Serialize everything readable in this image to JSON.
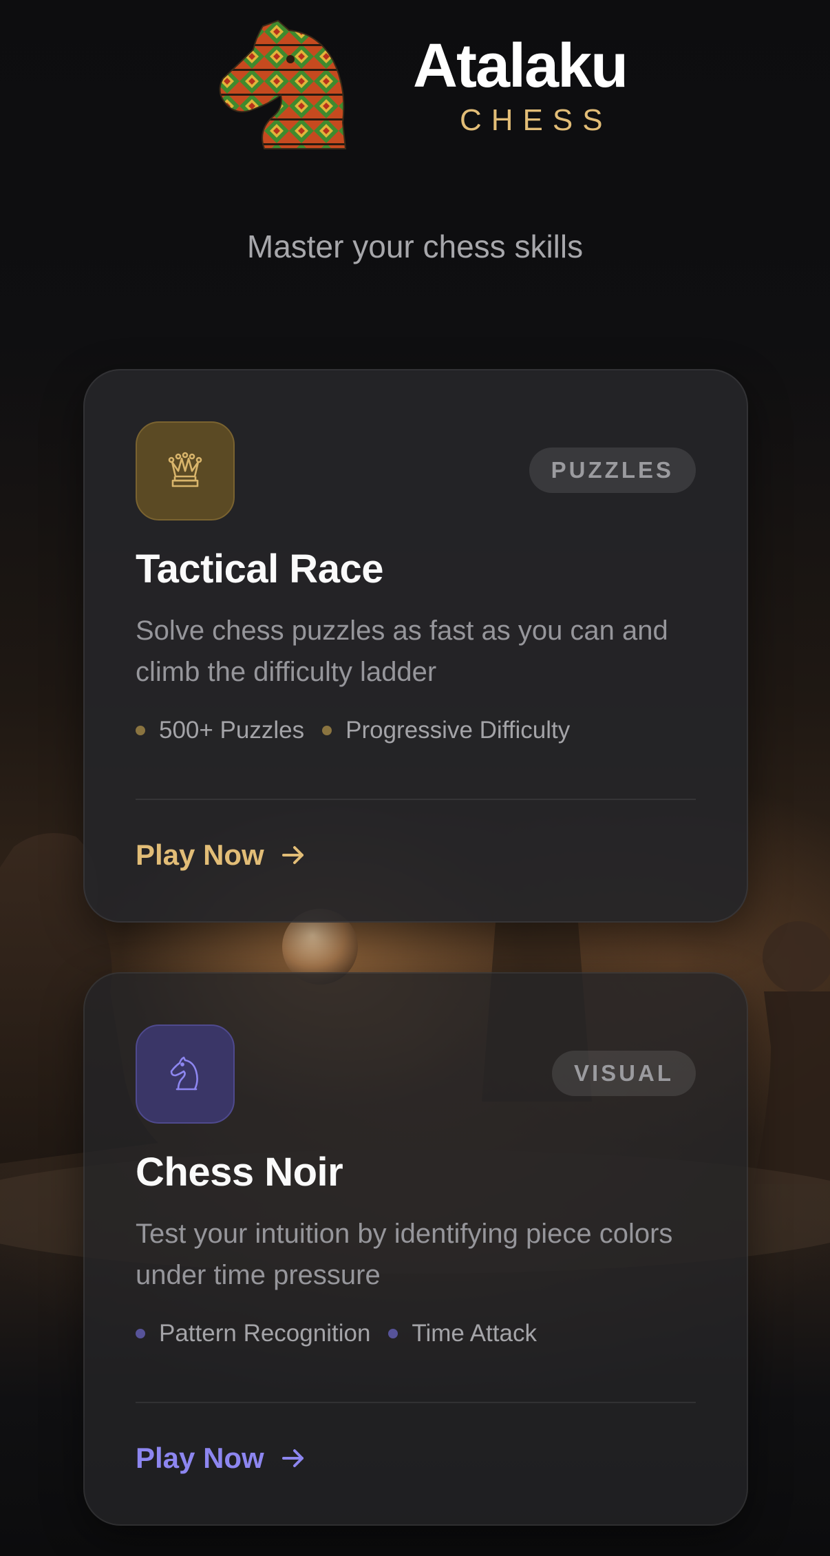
{
  "brand": {
    "name": "Atalaku",
    "subtitle": "CHESS",
    "logo_icon": "knight-logo-icon",
    "accent": "#e2bd77"
  },
  "tagline": "Master your chess skills",
  "cards": [
    {
      "icon": "queen-icon",
      "badge": "PUZZLES",
      "title": "Tactical Race",
      "description": "Solve chess puzzles as fast as you can and climb the difficulty ladder",
      "features": [
        "500+ Puzzles",
        "Progressive Difficulty"
      ],
      "cta": "Play Now",
      "accent": "#e2bd77"
    },
    {
      "icon": "knight-icon",
      "badge": "VISUAL",
      "title": "Chess Noir",
      "description": "Test your intuition by identifying piece colors under time pressure",
      "features": [
        "Pattern Recognition",
        "Time Attack"
      ],
      "cta": "Play Now",
      "accent": "#8d86f0"
    }
  ]
}
